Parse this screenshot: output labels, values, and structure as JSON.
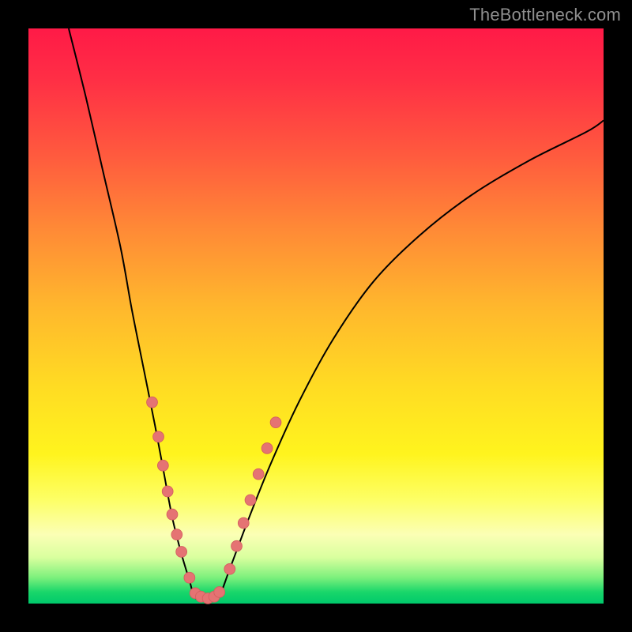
{
  "watermark": {
    "text": "TheBottleneck.com"
  },
  "colors": {
    "curve": "#000000",
    "marker_fill": "#e57373",
    "marker_stroke": "#d45f5f",
    "background_black": "#000000"
  },
  "chart_data": {
    "type": "line",
    "title": "",
    "xlabel": "",
    "ylabel": "",
    "xlim": [
      0,
      100
    ],
    "ylim": [
      0,
      100
    ],
    "grid": false,
    "note": "Axes are unlabeled in the image; values are estimated in percent of plot width/height. y=0 at bottom, y=100 at top, green toward bottom (good), red toward top (bad).",
    "series": [
      {
        "name": "left-curve",
        "x": [
          7,
          10,
          13,
          16,
          18,
          20,
          22,
          23.5,
          25,
          26.5,
          28,
          29
        ],
        "y": [
          100,
          88,
          75,
          62,
          51,
          41,
          31,
          23,
          15,
          9,
          4,
          1
        ]
      },
      {
        "name": "valley-floor",
        "x": [
          29,
          31,
          33
        ],
        "y": [
          1,
          0.5,
          1
        ]
      },
      {
        "name": "right-curve",
        "x": [
          33,
          35,
          38,
          42,
          47,
          53,
          60,
          68,
          77,
          87,
          97,
          100
        ],
        "y": [
          1,
          6,
          14,
          24,
          35,
          46,
          56,
          64,
          71,
          77,
          82,
          84
        ]
      }
    ],
    "markers": {
      "name": "data-points-along-curves",
      "points_xy": [
        [
          21.5,
          35
        ],
        [
          22.6,
          29
        ],
        [
          23.4,
          24
        ],
        [
          24.2,
          19.5
        ],
        [
          25.0,
          15.5
        ],
        [
          25.8,
          12
        ],
        [
          26.6,
          9
        ],
        [
          28.0,
          4.5
        ],
        [
          29.0,
          1.8
        ],
        [
          30.0,
          1.2
        ],
        [
          31.2,
          0.9
        ],
        [
          32.3,
          1.2
        ],
        [
          33.2,
          2.0
        ],
        [
          35.0,
          6
        ],
        [
          36.2,
          10
        ],
        [
          37.4,
          14
        ],
        [
          38.6,
          18
        ],
        [
          40.0,
          22.5
        ],
        [
          41.5,
          27
        ],
        [
          43.0,
          31.5
        ]
      ],
      "radius_pct": 0.95
    }
  }
}
